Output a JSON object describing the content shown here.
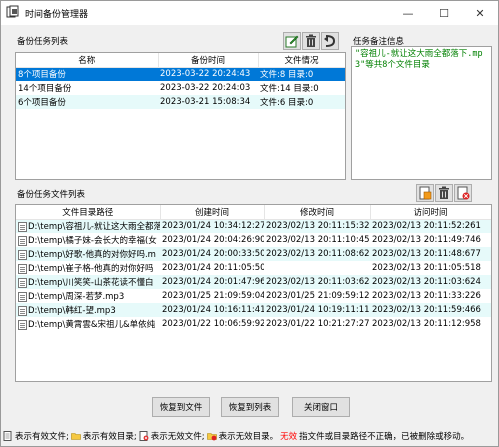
{
  "window": {
    "title": "时间备份管理器",
    "minimize": "—",
    "maximize": "☐",
    "close": "✕"
  },
  "tasks_label": "备份任务列表",
  "notes_label": "任务备注信息",
  "tasks_table": {
    "headers": [
      "名称",
      "备份时间",
      "文件情况"
    ],
    "rows": [
      {
        "name": "8个项目备份",
        "time": "2023-03-22 20:24:43",
        "status": "文件:8 目录:0"
      },
      {
        "name": "14个项目备份",
        "time": "2023-03-22 20:24:03",
        "status": "文件:14 目录:0"
      },
      {
        "name": "6个项目备份",
        "time": "2023-03-21 15:08:34",
        "status": "文件:6 目录:0"
      }
    ]
  },
  "note_text": "\"容祖儿-就让这大雨全都落下.mp3\"等共8个文件目录",
  "files_label": "备份任务文件列表",
  "files_table": {
    "headers": [
      "文件目录路径",
      "创建时间",
      "修改时间",
      "访问时间"
    ],
    "rows": [
      {
        "path": "D:\\temp\\容祖儿-就让这大雨全都落下",
        "created": "2023/01/24 10:34:12:276",
        "modified": "2023/02/13 20:11:15:321",
        "accessed": "2023/02/13 20:11:52:261"
      },
      {
        "path": "D:\\temp\\橘子妹-会长大的幸福(女",
        "created": "2023/01/24 20:04:26:909",
        "modified": "2023/02/13 20:11:10:450",
        "accessed": "2023/02/13 20:11:49:746"
      },
      {
        "path": "D:\\temp\\好歌-他真的对你好吗.m",
        "created": "2023/01/24 20:00:33:507",
        "modified": "2023/02/13 20:11:08:627",
        "accessed": "2023/02/13 20:11:48:677"
      },
      {
        "path": "D:\\temp\\崔子格-他真的对你好吗",
        "created": "2023/01/24 20:11:05:506",
        "modified": "",
        "accessed": "2023/02/13 20:11:05:518"
      },
      {
        "path": "D:\\temp\\川笑笑-山茶花读不懂白",
        "created": "2023/01/24 20:01:47:966",
        "modified": "2023/02/13 20:11:03:624",
        "accessed": "2023/02/13 20:11:03:624"
      },
      {
        "path": "D:\\temp\\周深-若梦.mp3",
        "created": "2023/01/25 21:09:59:049",
        "modified": "2023/01/25 21:09:59:128",
        "accessed": "2023/02/13 20:11:33:226"
      },
      {
        "path": "D:\\temp\\韩红-望.mp3",
        "created": "2023/01/24 10:16:11:411",
        "modified": "2023/01/24 10:19:11:116",
        "accessed": "2023/02/13 20:11:59:466"
      },
      {
        "path": "D:\\temp\\黄霄雲&宋祖儿&单依纯",
        "created": "2023/01/22 10:06:59:929",
        "modified": "2023/01/22 10:21:27:279",
        "accessed": "2023/02/13 20:11:12:958"
      }
    ]
  },
  "buttons": {
    "restore_file": "恢复到文件",
    "restore_list": "恢复到列表",
    "close_window": "关闭窗口"
  },
  "status": {
    "valid_file": "表示有效文件;",
    "valid_dir": "表示有效目录;",
    "invalid_file": "表示无效文件;",
    "invalid_dir": "表示无效目录。",
    "invalid_word": "无效",
    "tail": "指文件或目录路径不正确，已被删除或移动。"
  },
  "colors": {
    "selected": "#0078d7",
    "alt_row": "#e6fafa",
    "note_text": "#008000",
    "invalid_word": "#ff0000"
  }
}
